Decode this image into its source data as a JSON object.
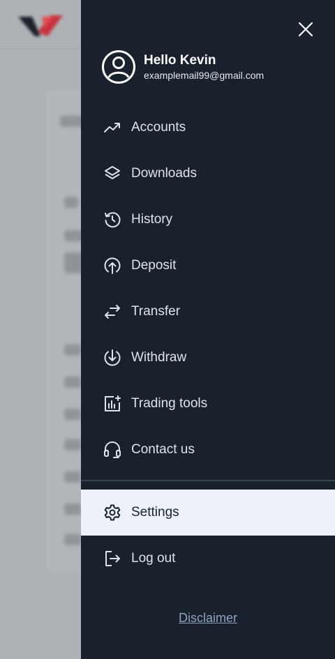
{
  "drawer": {
    "greeting": "Hello Kevin",
    "email": "examplemail99@gmail.com",
    "menu": [
      {
        "label": "Accounts",
        "icon": "trend-up-icon"
      },
      {
        "label": "Downloads",
        "icon": "layers-icon"
      },
      {
        "label": "History",
        "icon": "history-icon"
      },
      {
        "label": "Deposit",
        "icon": "upload-circle-icon"
      },
      {
        "label": "Transfer",
        "icon": "transfer-arrows-icon"
      },
      {
        "label": "Withdraw",
        "icon": "download-circle-icon"
      },
      {
        "label": "Trading tools",
        "icon": "chart-add-icon"
      },
      {
        "label": "Contact us",
        "icon": "headset-icon"
      }
    ],
    "settings_label": "Settings",
    "logout_label": "Log out",
    "disclaimer_label": "Disclaimer"
  },
  "colors": {
    "drawer_bg": "#18212c",
    "highlight_bg": "#edf1f8",
    "link": "#8fa2c2",
    "brand_red": "#d6303a"
  }
}
